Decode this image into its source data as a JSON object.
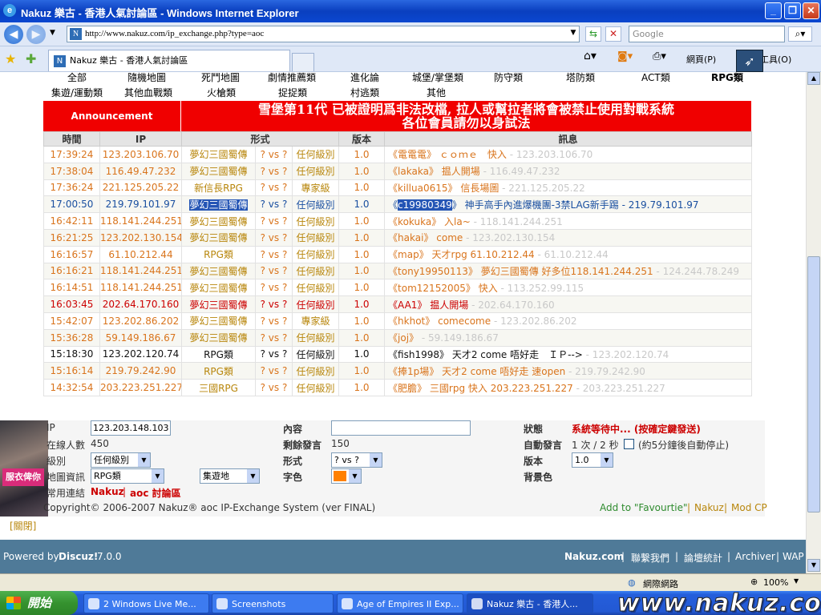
{
  "window": {
    "title": "Nakuz 樂古 - 香港人氣討論區 - Windows Internet Explorer"
  },
  "browser": {
    "url": "http://www.nakuz.com/ip_exchange.php?type=aoc",
    "search_placeholder": "Google",
    "tab_title": "Nakuz 樂古 - 香港人氣討論區",
    "page_menu": "網頁(P)",
    "tools_menu": "工具(O)"
  },
  "categories_row1": [
    "全部",
    "隨機地圖",
    "死鬥地圖",
    "劇情推薦類",
    "進化論",
    "城堡/掌堡類",
    "防守類",
    "塔防類",
    "ACT類",
    "RPG類"
  ],
  "categories_row2": [
    "集遊/運動類",
    "其他血戰類",
    "火槍類",
    "捉捉類",
    "村逃類",
    "其他"
  ],
  "announcement": {
    "label": "Announcement",
    "line1": "雪堡第11代 已被證明爲非法改檔, 拉人或幫拉者將會被禁止使用對戰系統",
    "line2": "各位會員請勿以身試法"
  },
  "table": {
    "headers": [
      "時間",
      "IP",
      "形式",
      "",
      "",
      "版本",
      "訊息"
    ],
    "rows": [
      {
        "time": "17:39:24",
        "ip": "123.203.106.70",
        "game": "夢幻三國蜀傳",
        "vs": "? vs ?",
        "level": "任何級別",
        "ver": "1.0",
        "name": "電電電",
        "text": " ｃｏｍｅ　快入",
        "ipmsg": " - 123.203.106.70",
        "color": "orange"
      },
      {
        "time": "17:38:04",
        "ip": "116.49.47.232",
        "game": "夢幻三國蜀傳",
        "vs": "? vs ?",
        "level": "任何級別",
        "ver": "1.0",
        "name": "lakaka",
        "text": " 揾人開場",
        "ipmsg": " - 116.49.47.232",
        "color": "orange"
      },
      {
        "time": "17:36:24",
        "ip": "221.125.205.22",
        "game": "新信長RPG",
        "vs": "? vs ?",
        "level": "專家級",
        "ver": "1.0",
        "name": "killua0615",
        "text": " 信長場圖",
        "ipmsg": " - 221.125.205.22",
        "color": "orange"
      },
      {
        "time": "17:00:50",
        "ip": "219.79.101.97",
        "game": "夢幻三國蜀傳",
        "vs": "? vs ?",
        "level": "任何級別",
        "ver": "1.0",
        "name": "c19980349",
        "text": " 神手高手內進爆機團-3禁LAG新手踢 - 219.79.101.97",
        "ipmsg": "",
        "color": "blue"
      },
      {
        "time": "16:42:11",
        "ip": "118.141.244.251",
        "game": "夢幻三國蜀傳",
        "vs": "? vs ?",
        "level": "任何級別",
        "ver": "1.0",
        "name": "kokuka",
        "text": " 入la~",
        "ipmsg": " - 118.141.244.251",
        "color": "orange"
      },
      {
        "time": "16:21:25",
        "ip": "123.202.130.154",
        "game": "夢幻三國蜀傳",
        "vs": "? vs ?",
        "level": "任何級別",
        "ver": "1.0",
        "name": "hakai",
        "text": " come",
        "ipmsg": " - 123.202.130.154",
        "color": "orange"
      },
      {
        "time": "16:16:57",
        "ip": "61.10.212.44",
        "game": "RPG類",
        "vs": "? vs ?",
        "level": "任何級別",
        "ver": "1.0",
        "name": "map",
        "text": " 天才rpg 61.10.212.44",
        "ipmsg": " - 61.10.212.44",
        "color": "orange"
      },
      {
        "time": "16:16:21",
        "ip": "118.141.244.251",
        "game": "夢幻三國蜀傳",
        "vs": "? vs ?",
        "level": "任何級別",
        "ver": "1.0",
        "name": "tony19950113",
        "text": " 夢幻三國蜀傳 好多位118.141.244.251",
        "ipmsg": " - 124.244.78.249",
        "color": "orange"
      },
      {
        "time": "16:14:51",
        "ip": "118.141.244.251",
        "game": "夢幻三國蜀傳",
        "vs": "? vs ?",
        "level": "任何級別",
        "ver": "1.0",
        "name": "tom12152005",
        "text": " 快入",
        "ipmsg": " - 113.252.99.115",
        "color": "orange"
      },
      {
        "time": "16:03:45",
        "ip": "202.64.170.160",
        "game": "夢幻三國蜀傳",
        "vs": "? vs ?",
        "level": "任何級別",
        "ver": "1.0",
        "name": "AA1",
        "text": " 揾人開場",
        "ipmsg": " - 202.64.170.160",
        "color": "red"
      },
      {
        "time": "15:42:07",
        "ip": "123.202.86.202",
        "game": "夢幻三國蜀傳",
        "vs": "? vs ?",
        "level": "專家級",
        "ver": "1.0",
        "name": "hkhot",
        "text": " comecome",
        "ipmsg": " - 123.202.86.202",
        "color": "orange"
      },
      {
        "time": "15:36:28",
        "ip": "59.149.186.67",
        "game": "夢幻三國蜀傳",
        "vs": "? vs ?",
        "level": "任何級別",
        "ver": "1.0",
        "name": "joj",
        "text": "",
        "ipmsg": " - 59.149.186.67",
        "color": "orange"
      },
      {
        "time": "15:18:30",
        "ip": "123.202.120.74",
        "game": "RPG類",
        "vs": "? vs ?",
        "level": "任何級別",
        "ver": "1.0",
        "name": "fish1998",
        "text": " 天才2 come 唔好走　ＩＰ-->",
        "ipmsg": " - 123.202.120.74",
        "color": "black"
      },
      {
        "time": "15:16:14",
        "ip": "219.79.242.90",
        "game": "RPG類",
        "vs": "? vs ?",
        "level": "任何級別",
        "ver": "1.0",
        "name": "捧1p場",
        "text": " 天才2 come 唔好走 速open",
        "ipmsg": " - 219.79.242.90",
        "color": "orange"
      },
      {
        "time": "14:32:54",
        "ip": "203.223.251.227",
        "game": "三國RPG",
        "vs": "? vs ?",
        "level": "任何級別",
        "ver": "1.0",
        "name": "肥膽",
        "text": " 三國rpg  快入 203.223.251.227",
        "ipmsg": " - 203.223.251.227",
        "color": "orange"
      }
    ]
  },
  "controls": {
    "ip_label": "IP",
    "ip_value": "123.203.148.103",
    "online_label": "在線人數",
    "online_value": "450",
    "level_label": "級別",
    "level_value": "任何級別",
    "map_label": "地圖資訊",
    "map_value": "RPG類",
    "map2_value": "集遊地",
    "links_label": "常用連結",
    "link1": "Nakuz",
    "link_sep": "|",
    "link2": "aoc 討論區",
    "content_label": "內容",
    "content_value": "",
    "remain_label": "剩餘發言",
    "remain_value": "150",
    "form_label": "形式",
    "form_value": "? vs ?",
    "fontcolor_label": "字色",
    "status_label": "狀態",
    "status_value": "系統等待中... (按確定鍵發送)",
    "auto_label": "自動發言",
    "auto_value": "1 次 / 2 秒",
    "auto_check": "(約5分鐘後自動停止)",
    "version_label": "版本",
    "version_value": "1.0",
    "bgcolor_label": "背景色",
    "copyright": "Copyright© 2006-2007  Nakuz® aoc IP-Exchange System (ver FINAL)",
    "add_fav": "Add to \"Favourtie\"",
    "nakuz_link": "Nakuz",
    "modcp": "Mod CP",
    "close_link": "[關閉]",
    "avatar_text": "服衣俾你"
  },
  "footer": {
    "powered": "Powered by",
    "discuz": "Discuz!",
    "ver": "7.0.0",
    "links": [
      "Nakuz.com",
      "聯繫我們",
      "論壇統計",
      "Archiver",
      "WAP"
    ]
  },
  "statusbar": {
    "zone": "網際網路",
    "zoom": "100%"
  },
  "taskbar": {
    "start": "開始",
    "tasks": [
      "2 Windows Live Me...",
      "Screenshots",
      "Age of Empires II Exp...",
      "Nakuz 樂古 - 香港人..."
    ],
    "watermark": "www.nakuz.com"
  },
  "colors": {
    "announcement_bg": "#f00000",
    "orange_text": "#d9741c",
    "blue_text": "#1a4fa0",
    "footer_bg": "#4f7a98"
  }
}
